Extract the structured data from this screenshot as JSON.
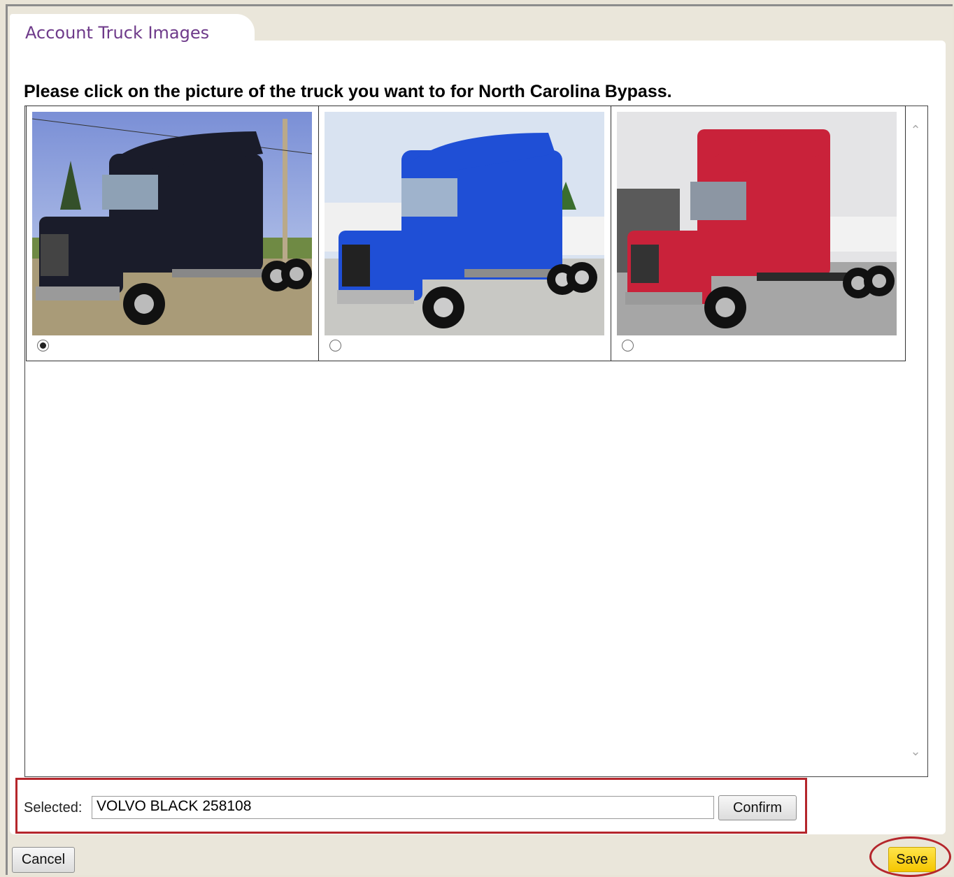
{
  "dialog": {
    "tab_title": "Account Truck Images",
    "instruction": "Please click on the picture of the truck you want to for North Carolina Bypass."
  },
  "trucks": [
    {
      "color_name": "black",
      "body_color": "#1a1c2a",
      "selected": true
    },
    {
      "color_name": "blue",
      "body_color": "#1f4fd6",
      "selected": false
    },
    {
      "color_name": "red",
      "body_color": "#c9223a",
      "selected": false
    }
  ],
  "selection": {
    "label": "Selected:",
    "value": "VOLVO BLACK  258108",
    "confirm_label": "Confirm"
  },
  "footer": {
    "cancel_label": "Cancel",
    "save_label": "Save"
  },
  "colors": {
    "highlight": "#b5262c",
    "tab_title": "#6e3a8a",
    "save_button": "#f5c600"
  }
}
